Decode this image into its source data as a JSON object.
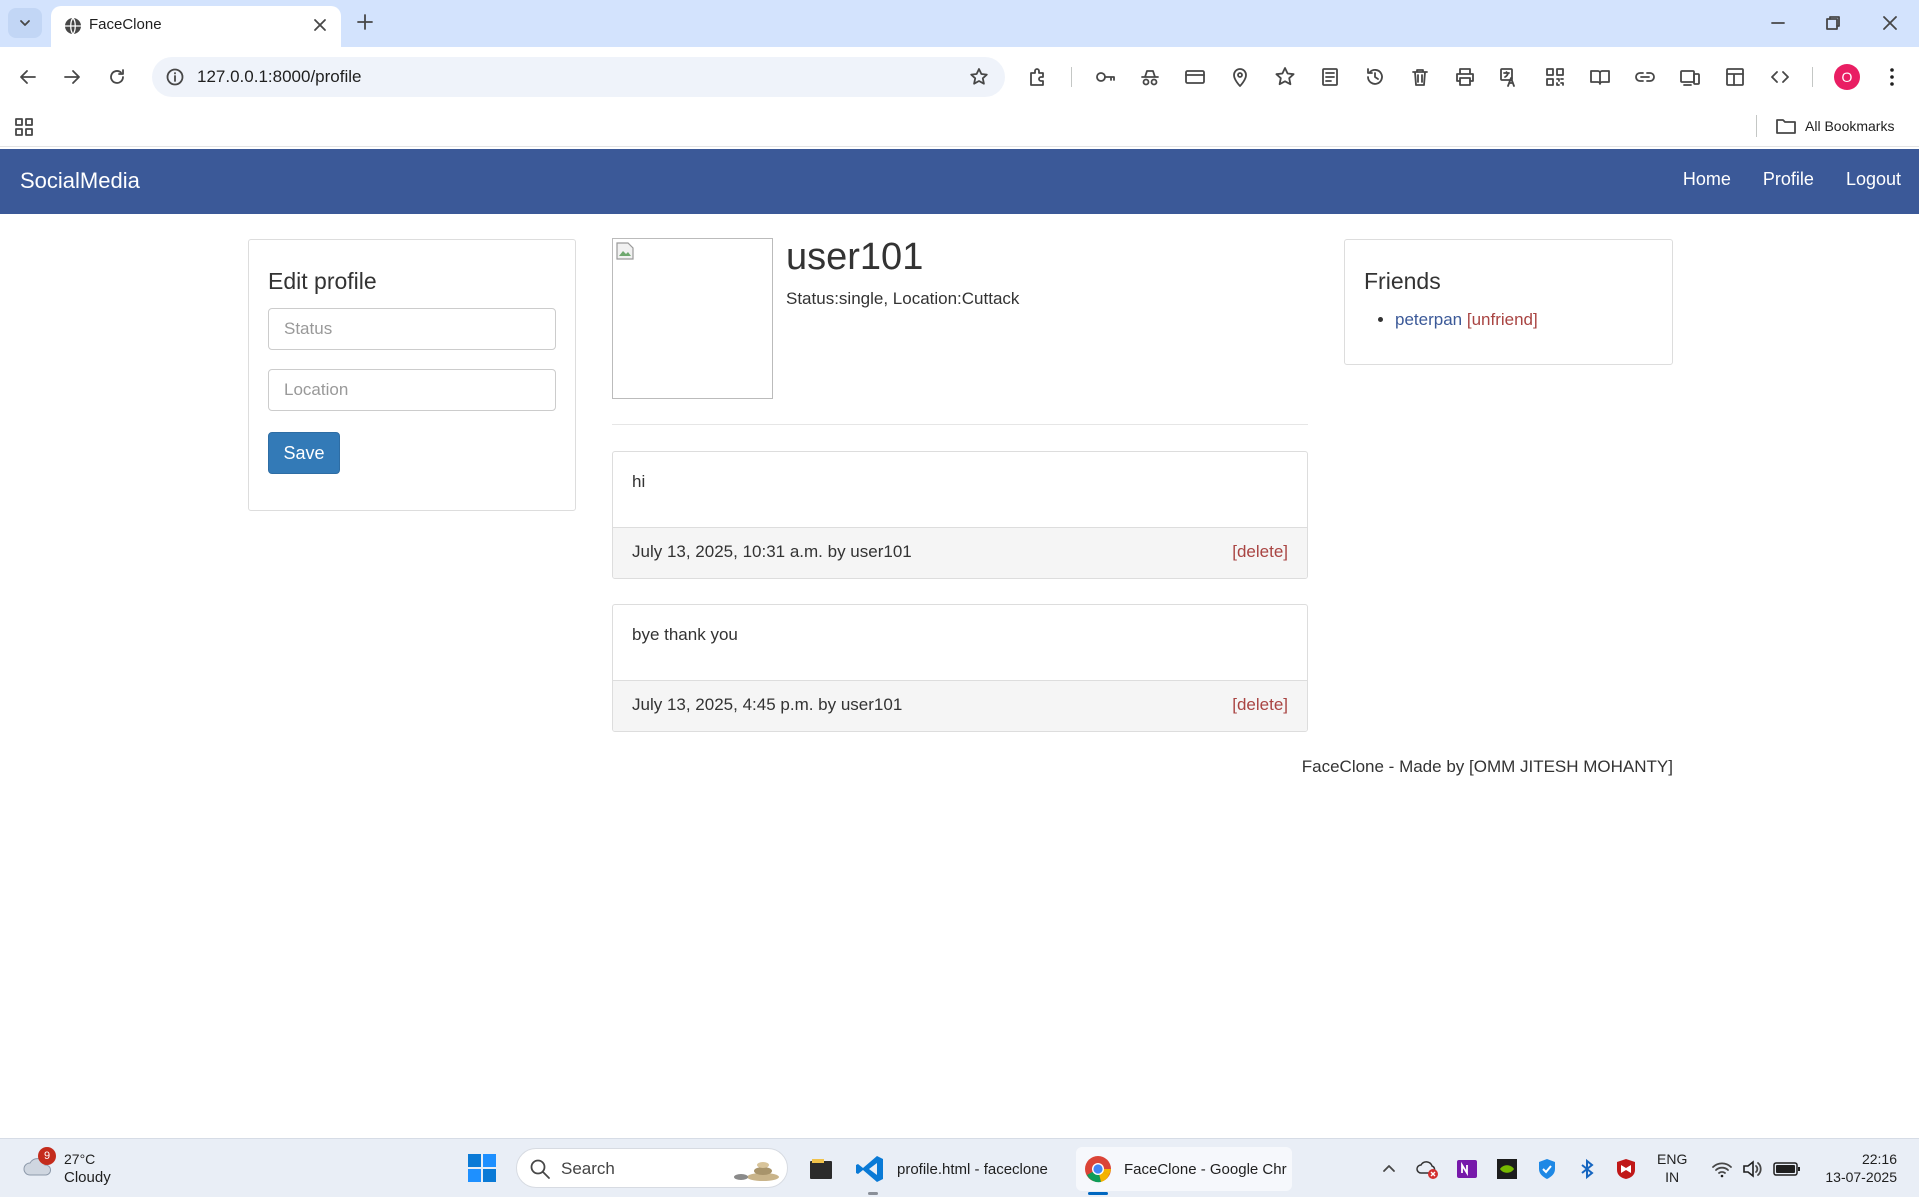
{
  "browser": {
    "tab_title": "FaceClone",
    "url": "127.0.0.1:8000/profile",
    "profile_initial": "O",
    "all_bookmarks": "All Bookmarks"
  },
  "navbar": {
    "brand": "SocialMedia",
    "links": [
      "Home",
      "Profile",
      "Logout"
    ],
    "color": "#3b5998"
  },
  "edit_profile": {
    "title": "Edit profile",
    "status_placeholder": "Status",
    "location_placeholder": "Location",
    "save_label": "Save"
  },
  "profile": {
    "username": "user101",
    "status_line": "Status:single, Location:Cuttack"
  },
  "posts": [
    {
      "text": "hi",
      "meta": "July 13, 2025, 10:31 a.m. by user101",
      "delete_label": "[delete]"
    },
    {
      "text": "bye thank you",
      "meta": "July 13, 2025, 4:45 p.m. by user101",
      "delete_label": "[delete]"
    }
  ],
  "friends": {
    "title": "Friends",
    "items": [
      {
        "name": "peterpan",
        "action": "[unfriend]"
      }
    ]
  },
  "footer": {
    "credit": "FaceClone - Made by [OMM JITESH MOHANTY]"
  },
  "taskbar": {
    "weather_badge": "9",
    "temperature": "27°C",
    "condition": "Cloudy",
    "search_label": "Search",
    "apps": [
      {
        "label": "profile.html - faceclone",
        "icon": "vscode-icon"
      },
      {
        "label": "FaceClone - Google Chr",
        "icon": "chrome-icon"
      }
    ],
    "lang_top": "ENG",
    "lang_bottom": "IN",
    "time": "22:16",
    "date": "13-07-2025"
  }
}
